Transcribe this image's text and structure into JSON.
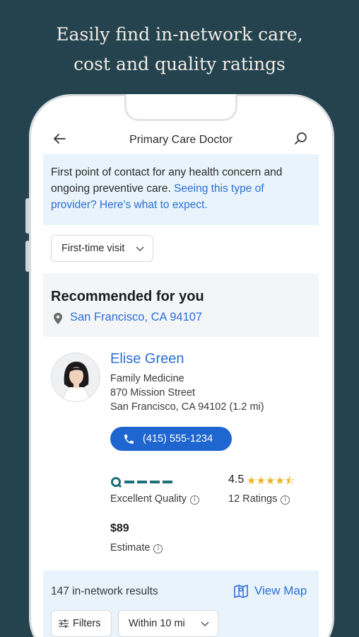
{
  "headline": {
    "line1": "Easily find in-network care,",
    "line2": "cost and quality ratings"
  },
  "topbar": {
    "title": "Primary Care Doctor",
    "back_icon": "arrow-left-icon",
    "search_icon": "search-icon"
  },
  "info": {
    "text": "First point of contact for any health concern and ongoing preventive care. ",
    "link": "Seeing this type of provider? Here's what to expect."
  },
  "visit_filter": {
    "selected": "First-time visit"
  },
  "recommended": {
    "title": "Recommended for you",
    "location": "San Francisco, CA 94107"
  },
  "doctor": {
    "name": "Elise Green",
    "specialty": "Family Medicine",
    "street": "870 Mission Street",
    "city_distance": "San Francisco, CA 94102 (1.2 mi)",
    "phone": "(415) 555-1234",
    "quality_label": "Excellent Quality",
    "quality_level": 5,
    "rating": "4.5",
    "stars": "★★★★⯪",
    "ratings_count": "12 Ratings",
    "price": "$89",
    "price_label": "Estimate"
  },
  "results": {
    "count": "147 in-network results",
    "view_map": "View Map",
    "filters_label": "Filters",
    "distance_selected": "Within 10 mi"
  },
  "colors": {
    "background": "#24434f",
    "accent_blue": "#2a6fd6",
    "info_bg": "#e8f3fc",
    "star": "#f2b01e",
    "quality_teal": "#1e6f7a"
  }
}
